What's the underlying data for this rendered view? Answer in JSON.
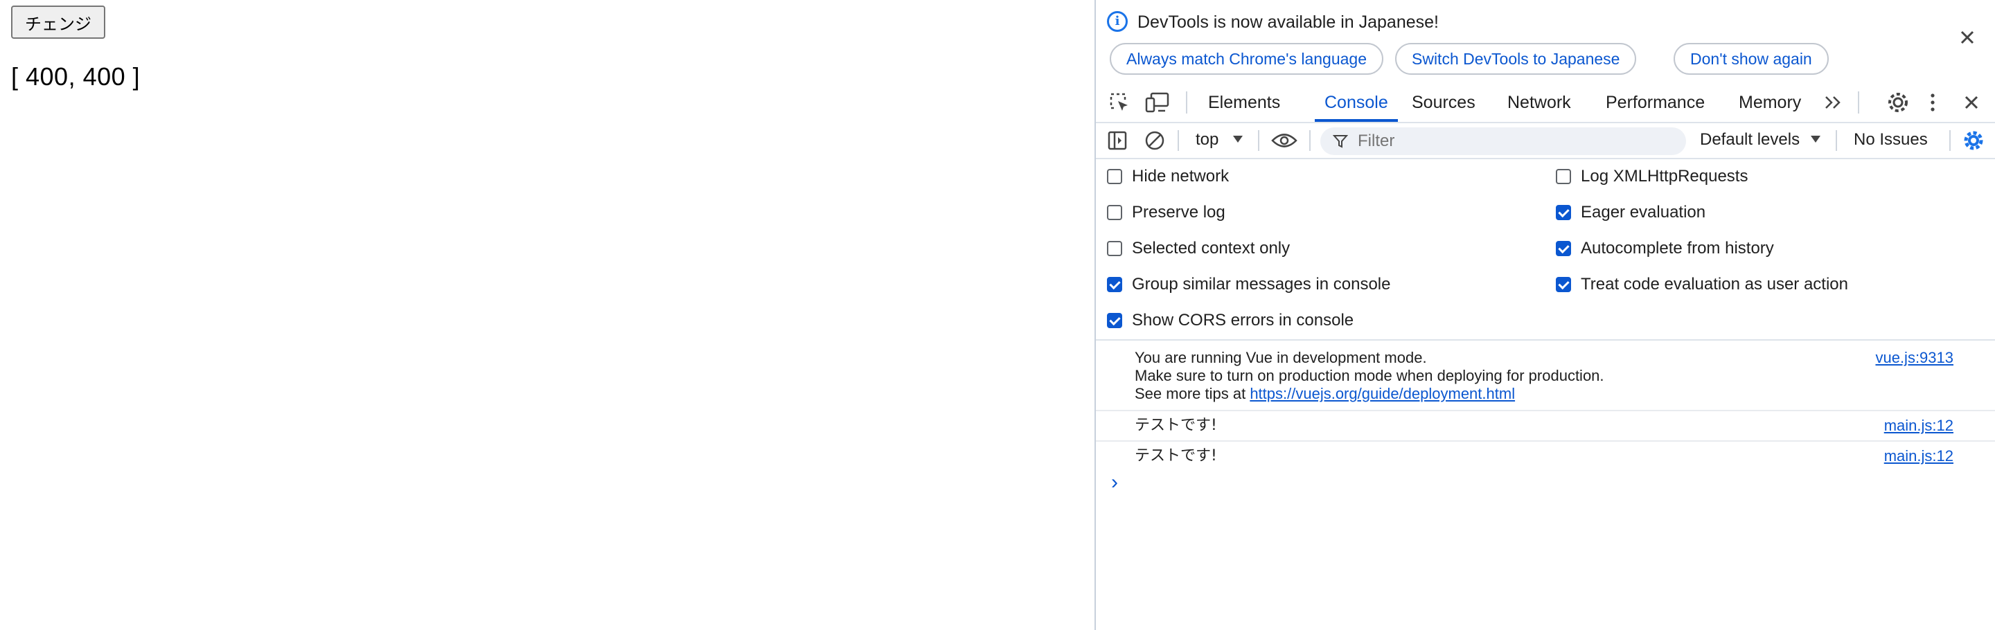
{
  "page": {
    "button_label": "チェンジ",
    "array_text": "[ 400, 400 ]"
  },
  "devtools": {
    "infobar": {
      "message": "DevTools is now available in Japanese!",
      "buttons": [
        "Always match Chrome's language",
        "Switch DevTools to Japanese",
        "Don't show again"
      ]
    },
    "tabs": [
      "Elements",
      "Console",
      "Sources",
      "Network",
      "Performance",
      "Memory"
    ],
    "active_tab": "Console",
    "toolbar": {
      "context": "top",
      "filter_placeholder": "Filter",
      "levels": "Default levels",
      "issues": "No Issues"
    },
    "settings_left": [
      {
        "label": "Hide network",
        "checked": false
      },
      {
        "label": "Preserve log",
        "checked": false
      },
      {
        "label": "Selected context only",
        "checked": false
      },
      {
        "label": "Group similar messages in console",
        "checked": true
      },
      {
        "label": "Show CORS errors in console",
        "checked": true
      }
    ],
    "settings_right": [
      {
        "label": "Log XMLHttpRequests",
        "checked": false
      },
      {
        "label": "Eager evaluation",
        "checked": true
      },
      {
        "label": "Autocomplete from history",
        "checked": true
      },
      {
        "label": "Treat code evaluation as user action",
        "checked": true
      }
    ],
    "messages": {
      "vue_line1": "You are running Vue in development mode.",
      "vue_line2": "Make sure to turn on production mode when deploying for production.",
      "vue_line3_prefix": "See more tips at ",
      "vue_link": "https://vuejs.org/guide/deployment.html",
      "vue_source": "vue.js:9313",
      "log1_text": "テストです!",
      "log1_source": "main.js:12",
      "log2_text": "テストです!",
      "log2_source": "main.js:12"
    },
    "prompt": "›",
    "colors": {
      "accent": "#0b57d0",
      "info": "#1a73e8"
    }
  }
}
